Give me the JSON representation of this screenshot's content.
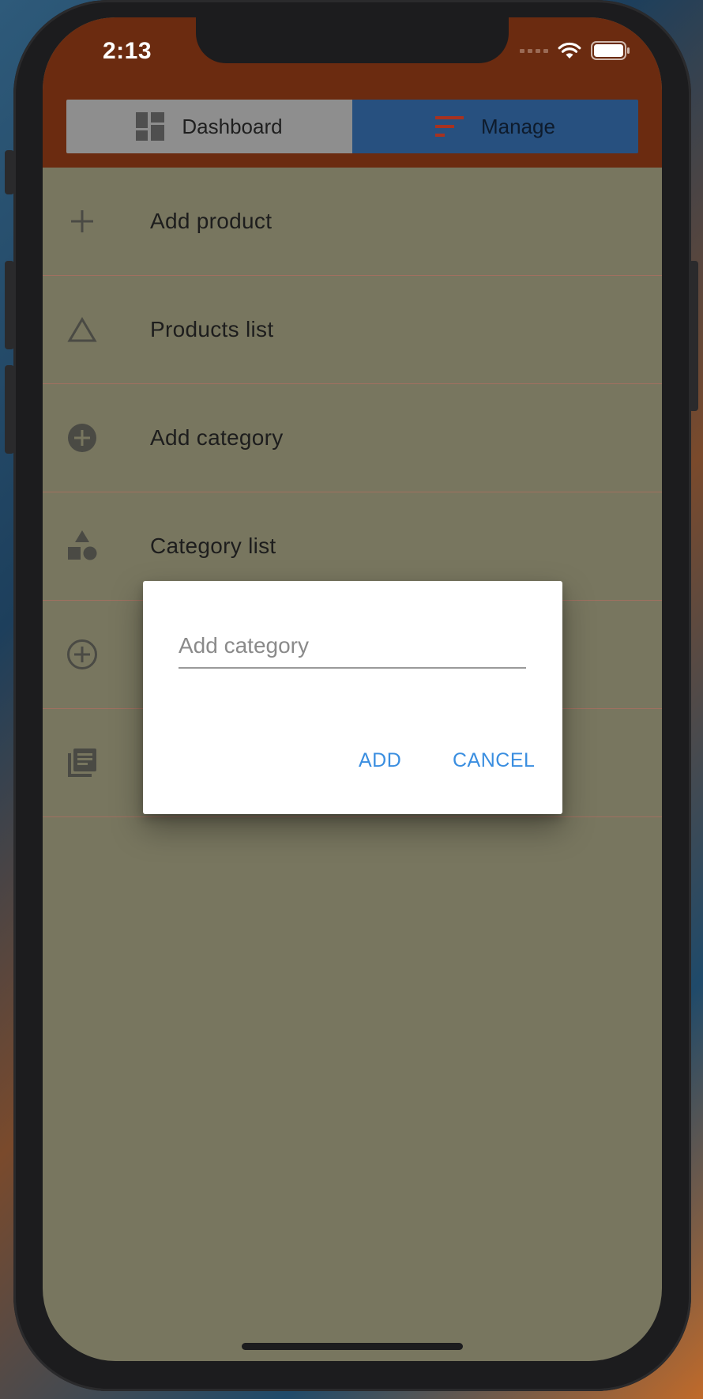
{
  "status_bar": {
    "time": "2:13"
  },
  "tabs": [
    {
      "label": "Dashboard",
      "icon": "dashboard-icon",
      "active": false
    },
    {
      "label": "Manage",
      "icon": "sort-icon",
      "active": true
    }
  ],
  "menu": {
    "items": [
      {
        "label": "Add product",
        "icon": "plus-icon"
      },
      {
        "label": "Products list",
        "icon": "triangle-outline-icon"
      },
      {
        "label": "Add category",
        "icon": "plus-circle-filled-icon"
      },
      {
        "label": "Category list",
        "icon": "category-shapes-icon"
      },
      {
        "label": "",
        "icon": "plus-circle-outline-icon"
      },
      {
        "label": "",
        "icon": "library-books-icon"
      }
    ]
  },
  "dialog": {
    "input_placeholder": "Add category",
    "input_value": "",
    "add_label": "ADD",
    "cancel_label": "CANCEL"
  },
  "colors": {
    "header": "#6b2b10",
    "manage_tab": "#27507f",
    "dashboard_tab": "#8e8e8e",
    "overlay_bg": "#78765f",
    "dialog_button": "#3a8ee0"
  }
}
